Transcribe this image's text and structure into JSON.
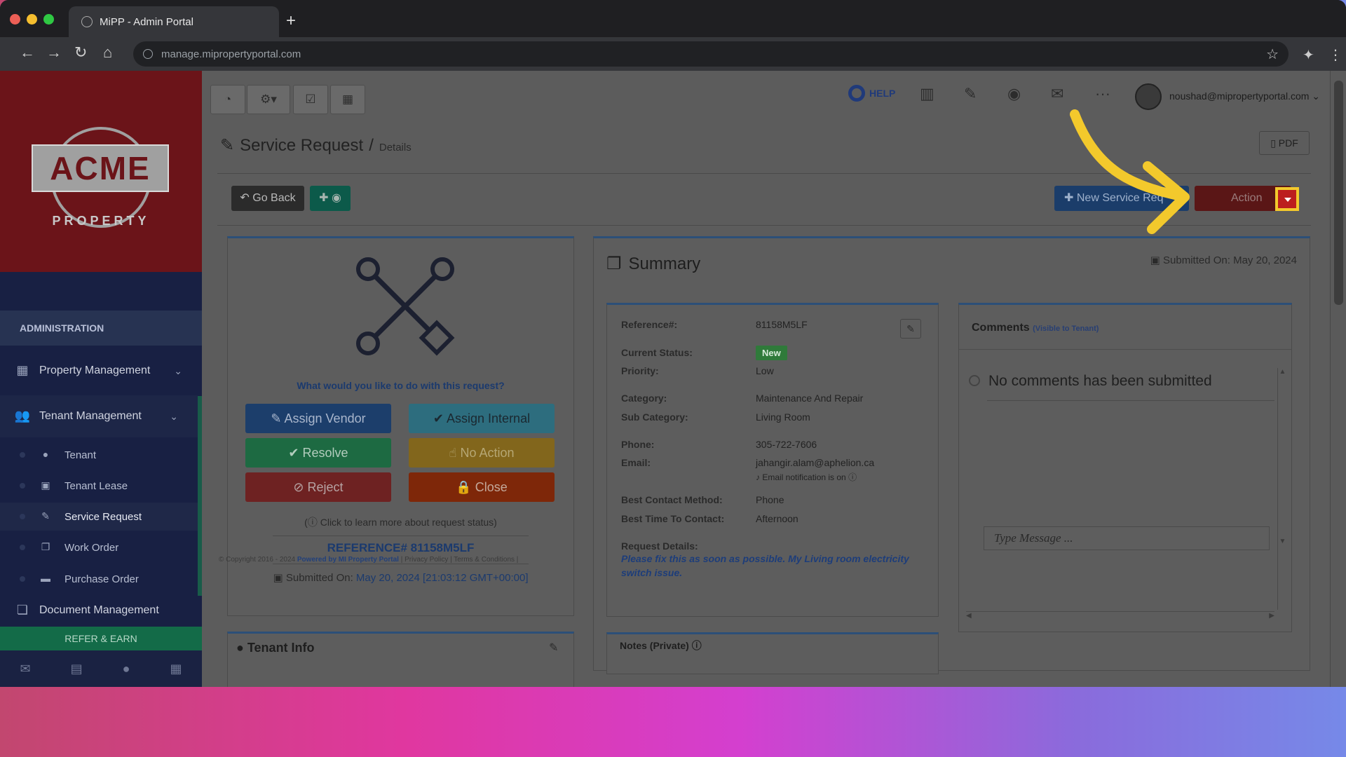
{
  "browser": {
    "tab_title": "MiPP - Admin Portal",
    "url": "manage.mipropertyportal.com"
  },
  "logo": {
    "brand": "ACME",
    "tagline": "PROPERTY"
  },
  "sidebar": {
    "section_title": "ADMINISTRATION",
    "items": [
      {
        "label": "Property Management",
        "icon": "building-icon"
      },
      {
        "label": "Tenant Management",
        "icon": "users-icon"
      },
      {
        "label": "Document Management",
        "icon": "documents-icon"
      }
    ],
    "sub_items": [
      {
        "label": "Tenant",
        "icon": "user-icon"
      },
      {
        "label": "Tenant Lease",
        "icon": "calendar-check-icon"
      },
      {
        "label": "Service Request",
        "icon": "wrench-icon"
      },
      {
        "label": "Work Order",
        "icon": "copy-icon"
      },
      {
        "label": "Purchase Order",
        "icon": "truck-icon"
      }
    ],
    "refer_label": "REFER & EARN"
  },
  "topbar": {
    "help_label": "HELP",
    "user_email": "noushad@mipropertyportal.com"
  },
  "page": {
    "title": "Service Request",
    "breadcrumb_sep": "/",
    "subtitle": "Details",
    "pdf_label": "PDF",
    "go_back_label": "Go Back",
    "new_sr_label": "New Service Req",
    "actions_label": "Action"
  },
  "request_panel": {
    "question": "What would you like to do with this request?",
    "buttons": {
      "assign_vendor": "Assign Vendor",
      "assign_internal": "Assign Internal",
      "resolve": "Resolve",
      "no_action": "No Action",
      "reject": "Reject",
      "close": "Close"
    },
    "learn_more": "Click to learn more about request status)",
    "reference_label": "REFERENCE#",
    "reference_value": "81158M5LF",
    "submitted_label": "Submitted On:",
    "submitted_value": "May 20, 2024 [21:03:12 GMT+00:00]"
  },
  "tenant_info": {
    "title": "Tenant Info"
  },
  "summary": {
    "title": "Summary",
    "submitted_label": "Submitted On:",
    "submitted_value": "May 20, 2024",
    "fields": {
      "reference_label": "Reference#:",
      "reference_value": "81158M5LF",
      "status_label": "Current Status:",
      "status_value": "New",
      "priority_label": "Priority:",
      "priority_value": "Low",
      "category_label": "Category:",
      "category_value": "Maintenance And Repair",
      "subcategory_label": "Sub Category:",
      "subcategory_value": "Living Room",
      "phone_label": "Phone:",
      "phone_value": "305-722-7606",
      "email_label": "Email:",
      "email_value": "jahangir.alam@aphelion.ca",
      "email_notification": "Email notification is on",
      "contact_method_label": "Best Contact Method:",
      "contact_method_value": "Phone",
      "contact_time_label": "Best Time To Contact:",
      "contact_time_value": "Afternoon",
      "details_label": "Request Details:",
      "details_value": "Please fix this as soon as possible. My Living room electricity switch issue."
    },
    "notes_title": "Notes (Private)"
  },
  "comments": {
    "title": "Comments",
    "visibility": "(Visible to Tenant)",
    "empty_text": "No comments has been submitted",
    "input_placeholder": "Type Message ..."
  },
  "footer": {
    "copyright": "© Copyright 2016 - 2024",
    "powered": "Powered by MI Property Portal",
    "links": "| Privacy Policy | Terms & Conditions |"
  },
  "colors": {
    "highlight_yellow": "#f3c92c",
    "action_red": "#bc1e1e",
    "sidebar_navy": "#182043"
  }
}
